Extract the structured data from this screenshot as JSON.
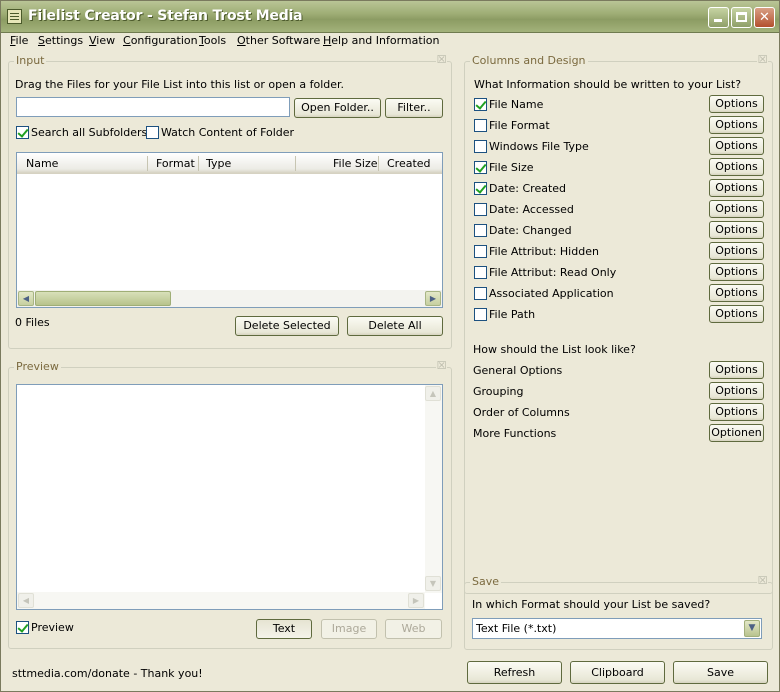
{
  "window": {
    "title": "Filelist Creator - Stefan Trost Media"
  },
  "menu": [
    "File",
    "Settings",
    "View",
    "Configuration",
    "Tools",
    "Other Software",
    "Help and Information"
  ],
  "input": {
    "group_title": "Input",
    "instruction": "Drag the Files for your File List into this list or open a folder.",
    "path_value": "",
    "open_folder_label": "Open Folder..",
    "filter_label": "Filter..",
    "search_subfolders_label": "Search all Subfolders",
    "search_subfolders_checked": true,
    "watch_content_label": "Watch Content of Folder",
    "watch_content_checked": false,
    "columns": [
      "Name",
      "Format",
      "Type",
      "File Size",
      "Created"
    ],
    "file_count": "0 Files",
    "delete_selected_label": "Delete Selected",
    "delete_all_label": "Delete All"
  },
  "preview": {
    "group_title": "Preview",
    "preview_label": "Preview",
    "preview_checked": true,
    "text_label": "Text",
    "image_label": "Image",
    "web_label": "Web"
  },
  "columns_design": {
    "group_title": "Columns and Design",
    "question": "What Information should be written to your List?",
    "fields": [
      {
        "label": "File Name",
        "checked": true,
        "button": "Options"
      },
      {
        "label": "File Format",
        "checked": false,
        "button": "Options"
      },
      {
        "label": "Windows File Type",
        "checked": false,
        "button": "Options"
      },
      {
        "label": "File Size",
        "checked": true,
        "button": "Options"
      },
      {
        "label": "Date: Created",
        "checked": true,
        "button": "Options"
      },
      {
        "label": "Date: Accessed",
        "checked": false,
        "button": "Options"
      },
      {
        "label": "Date: Changed",
        "checked": false,
        "button": "Options"
      },
      {
        "label": "File Attribut: Hidden",
        "checked": false,
        "button": "Options"
      },
      {
        "label": "File Attribut: Read Only",
        "checked": false,
        "button": "Options"
      },
      {
        "label": "Associated Application",
        "checked": false,
        "button": "Options"
      },
      {
        "label": "File Path",
        "checked": false,
        "button": "Options"
      }
    ],
    "look_question": "How should the List look like?",
    "look_items": [
      {
        "label": "General Options",
        "button": "Options"
      },
      {
        "label": "Grouping",
        "button": "Options"
      },
      {
        "label": "Order of Columns",
        "button": "Options"
      },
      {
        "label": "More Functions",
        "button": "Optionen"
      }
    ]
  },
  "save": {
    "group_title": "Save",
    "question": "In which Format should your List be saved?",
    "format_value": "Text File (*.txt)"
  },
  "footer": {
    "donate_text": "sttmedia.com/donate - Thank you!",
    "refresh_label": "Refresh",
    "clipboard_label": "Clipboard",
    "save_label": "Save"
  }
}
